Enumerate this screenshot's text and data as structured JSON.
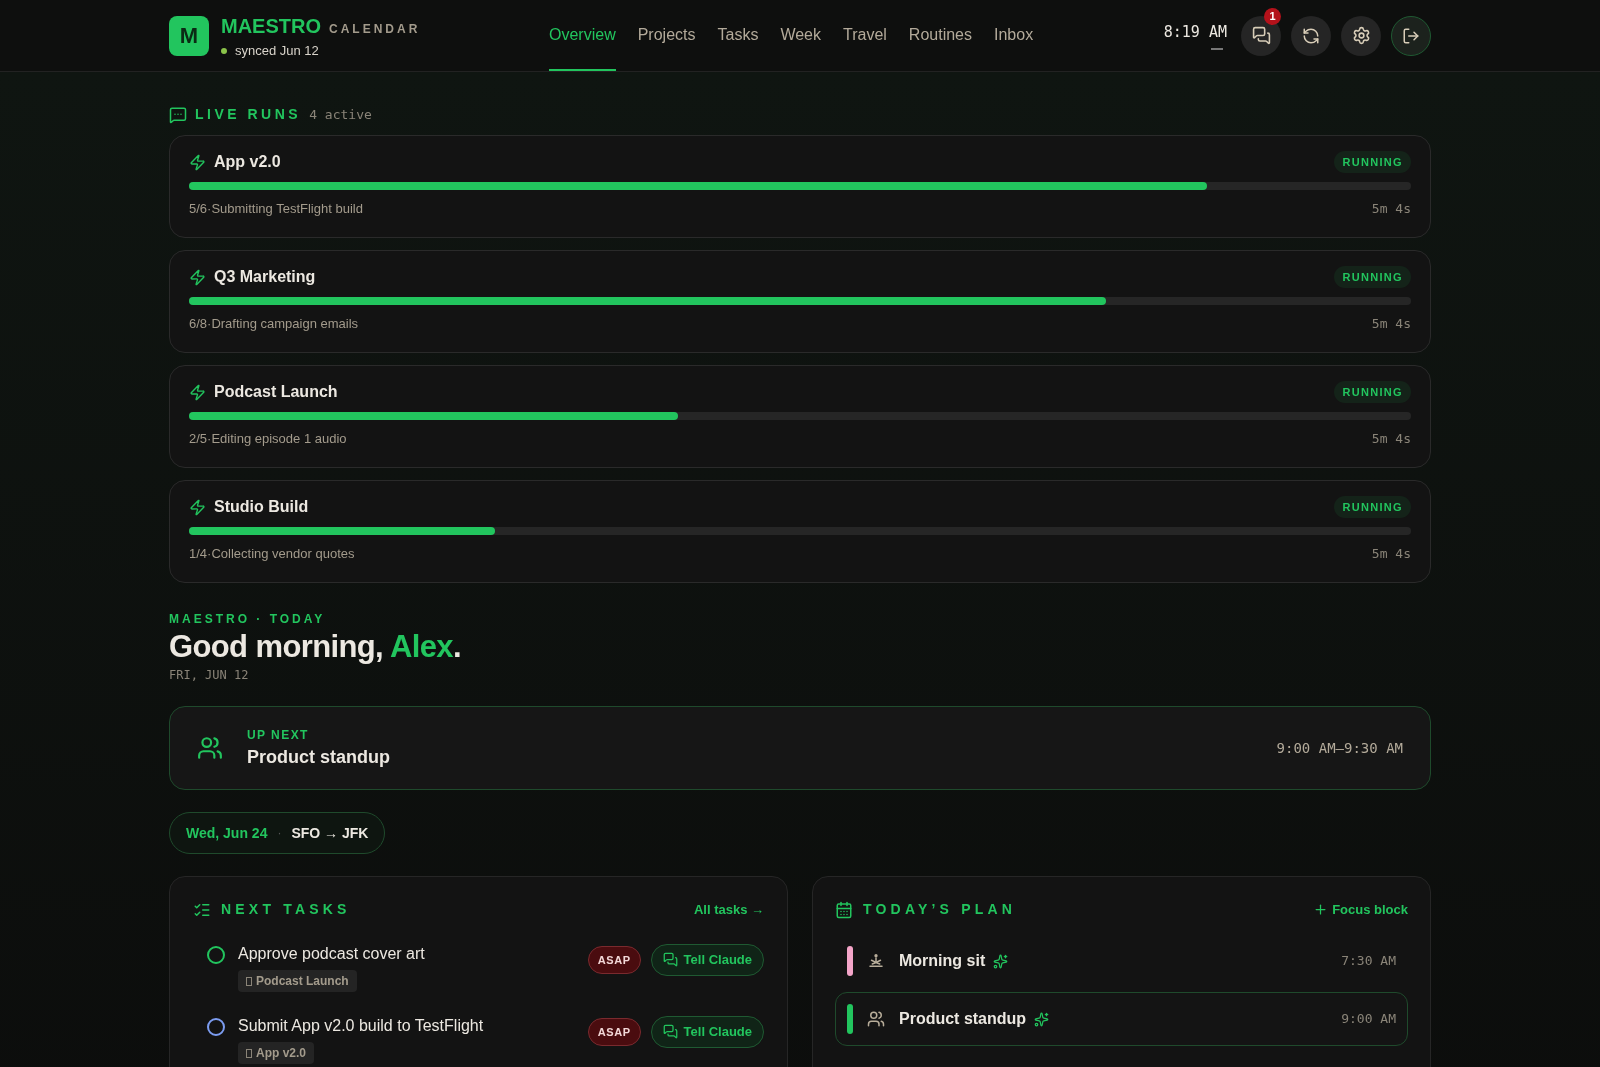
{
  "header": {
    "logo_letter": "M",
    "brand": "MAESTRO",
    "subtitle": "CALENDAR",
    "sync_status": "synced Jun 12",
    "nav": [
      {
        "label": "Overview",
        "selected": true
      },
      {
        "label": "Projects",
        "selected": false
      },
      {
        "label": "Tasks",
        "selected": false
      },
      {
        "label": "Week",
        "selected": false
      },
      {
        "label": "Travel",
        "selected": false
      },
      {
        "label": "Routines",
        "selected": false
      },
      {
        "label": "Inbox",
        "selected": false
      }
    ],
    "clock": "8:19 AM",
    "messages_badge": "1"
  },
  "live_runs": {
    "title": "LIVE RUNS",
    "count": "4 active",
    "runs": [
      {
        "name": "App v2.0",
        "status": "RUNNING",
        "level": 0.833,
        "step": "5/6·Submitting TestFlight build",
        "elapsed": "5m 4s"
      },
      {
        "name": "Q3 Marketing",
        "status": "RUNNING",
        "level": 0.75,
        "step": "6/8·Drafting campaign emails",
        "elapsed": "5m 4s"
      },
      {
        "name": "Podcast Launch",
        "status": "RUNNING",
        "level": 0.4,
        "step": "2/5·Editing episode 1 audio",
        "elapsed": "5m 4s"
      },
      {
        "name": "Studio Build",
        "status": "RUNNING",
        "level": 0.25,
        "step": "1/4·Collecting vendor quotes",
        "elapsed": "5m 4s"
      }
    ]
  },
  "today": {
    "eyebrow": "MAESTRO · TODAY",
    "greeting": "Good morning,",
    "name": "Alex",
    "punctuation": ".",
    "date": "FRI, JUN 12"
  },
  "up_next": {
    "label": "UP NEXT",
    "title": "Product standup",
    "time": "9:00 AM–9:30 AM"
  },
  "trip": {
    "date": "Wed, Jun 24",
    "separator": "·",
    "route": "SFO → JFK"
  },
  "next_tasks": {
    "title": "NEXT TASKS",
    "link": "All tasks →",
    "tasks": [
      {
        "title": "Approve podcast cover art",
        "project": "Podcast Launch",
        "priority": "ASAP",
        "action": "Tell Claude",
        "color": "#22c55e"
      },
      {
        "title": "Submit App v2.0 build to TestFlight",
        "project": "App v2.0",
        "priority": "ASAP",
        "action": "Tell Claude",
        "color": "#7c9cf0"
      }
    ]
  },
  "todays_plan": {
    "title": "TODAY’S PLAN",
    "action": "Focus block",
    "items": [
      {
        "title": "Morning sit",
        "time": "7:30 AM",
        "color": "#f4a5c8",
        "kind": "meditation",
        "selected": false
      },
      {
        "title": "Product standup",
        "time": "9:00 AM",
        "color": "#22c55e",
        "kind": "meeting",
        "selected": true
      }
    ]
  }
}
